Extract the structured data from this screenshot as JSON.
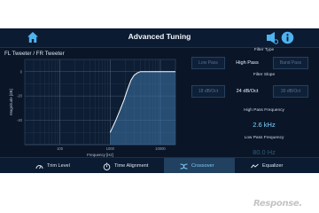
{
  "header": {
    "title": "Advanced Tuning",
    "home_icon": "home-icon",
    "speaker_icon": "speaker-settings-icon",
    "info_icon": "info-icon"
  },
  "chart_panel": {
    "channel_label": "FL Tweeter / FR Tweeter"
  },
  "filter_type": {
    "title": "Filter Type",
    "options": [
      "Low Pass",
      "High Pass",
      "Band Pass"
    ],
    "selected": "High Pass"
  },
  "filter_slope": {
    "title": "Filter Slope",
    "options": [
      "18 dB/Oct",
      "24 dB/Oct",
      "30 dB/Oct"
    ],
    "selected": "24 dB/Oct"
  },
  "high_pass": {
    "title": "High Pass Frequency",
    "value": "2.6 kHz"
  },
  "low_pass": {
    "title": "Low Pass Frequency",
    "value": "80.0 Hz"
  },
  "tabs": [
    {
      "label": "Trim Level",
      "icon": "gauge-icon"
    },
    {
      "label": "Time Alignment",
      "icon": "stopwatch-icon"
    },
    {
      "label": "Crossover",
      "icon": "crossover-icon",
      "active": true
    },
    {
      "label": "Equalizer",
      "icon": "equalizer-icon"
    }
  ],
  "watermark": "Response.",
  "colors": {
    "background": "#0a1628",
    "accent": "#7fcff8",
    "curve": "#ffffff"
  },
  "chart_data": {
    "type": "area",
    "xscale": "log",
    "xlabel": "Frequency [Hz]",
    "ylabel": "Magnitude [dB]",
    "x_ticks": [
      "100",
      "1000",
      "10000"
    ],
    "y_ticks": [
      "0",
      "-20",
      "-40"
    ],
    "xlim": [
      20,
      20000
    ],
    "ylim": [
      -60,
      10
    ],
    "grid": true,
    "series": [
      {
        "x": [
          1000,
          1300,
          1600,
          1900,
          2200,
          2600,
          3000,
          3500,
          4000,
          5000,
          6000,
          20000
        ],
        "y": [
          -50,
          -40,
          -31,
          -23,
          -15,
          -7,
          -3,
          -1,
          0,
          0,
          0,
          0
        ]
      }
    ]
  }
}
